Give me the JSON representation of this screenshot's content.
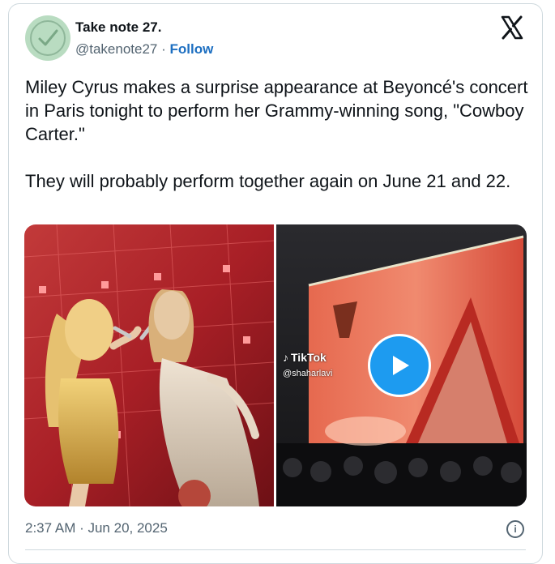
{
  "author": {
    "name": "Take note 27.",
    "handle": "@takenote27",
    "separator": " · ",
    "follow_label": "Follow",
    "avatar_icon": "checkmark-circle-icon"
  },
  "logo_icon": "x-logo-icon",
  "tweet": {
    "text": "Miley Cyrus makes a surprise appearance at Beyoncé's concert in Paris tonight to perform her Grammy-winning song, \"Cowboy Carter.\"\n\nThey will probably perform together again on June 21 and 22."
  },
  "media": {
    "tiktok_label": "TikTok",
    "tiktok_handle": "@shaharlavi",
    "play_icon": "play-icon"
  },
  "footer": {
    "timestamp": "2:37 AM · Jun 20, 2025",
    "info_icon": "info-icon"
  },
  "colors": {
    "follow": "#1d6fc1",
    "play_button": "#1d9bf0",
    "border": "#cfd9de",
    "muted_text": "#536471"
  }
}
